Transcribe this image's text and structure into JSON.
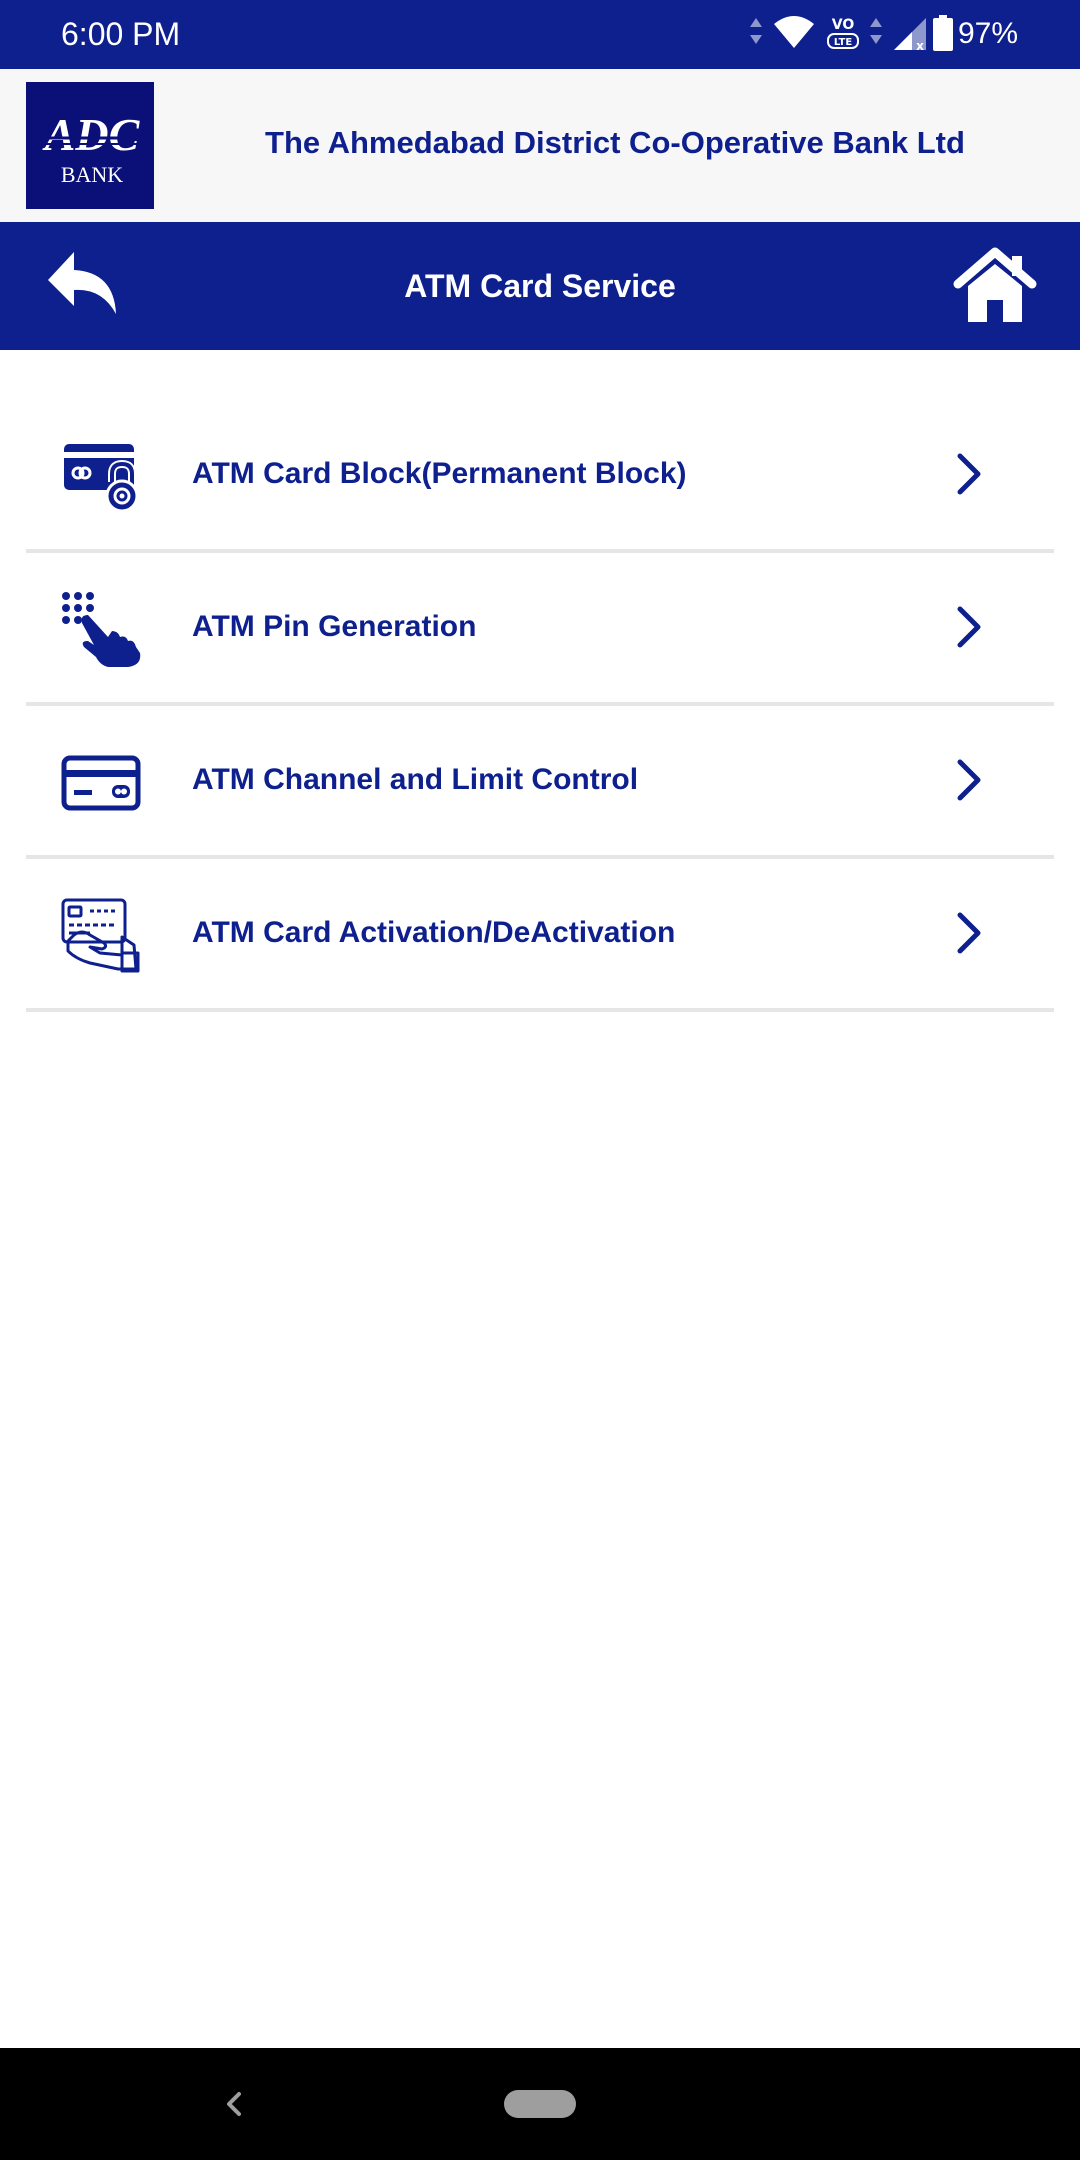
{
  "status_bar": {
    "time": "6:00 PM",
    "battery": "97%",
    "icons": [
      "data-arrows-icon",
      "wifi-icon",
      "volte-icon",
      "signal-icon",
      "battery-icon"
    ]
  },
  "header": {
    "logo_text": "ADC",
    "logo_subtext": "BANK",
    "bank_name": "The Ahmedabad District Co-Operative Bank Ltd"
  },
  "title_bar": {
    "title": "ATM Card Service",
    "back_icon": "reply-arrow-icon",
    "home_icon": "home-icon"
  },
  "menu": {
    "items": [
      {
        "label": "ATM Card Block(Permanent Block)",
        "icon": "card-lock-icon"
      },
      {
        "label": "ATM Pin Generation",
        "icon": "keypad-touch-icon"
      },
      {
        "label": "ATM Channel and Limit Control",
        "icon": "credit-card-icon"
      },
      {
        "label": "ATM Card Activation/DeActivation",
        "icon": "hand-card-icon"
      }
    ]
  },
  "colors": {
    "primary": "#0e1f8e",
    "logo_bg": "#0b0f78",
    "header_bg": "#f7f7f7",
    "divider": "#e6e6e6",
    "nav_bg": "#000000"
  }
}
